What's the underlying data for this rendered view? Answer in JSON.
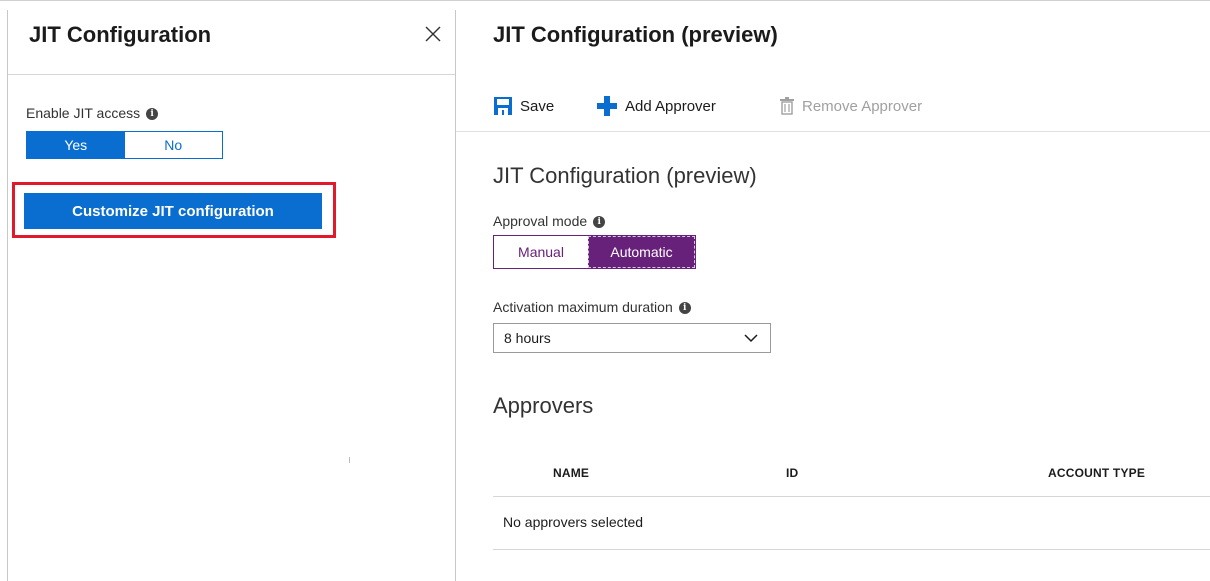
{
  "left_panel": {
    "title": "JIT Configuration",
    "enable_label": "Enable JIT access",
    "enable_toggle": {
      "yes": "Yes",
      "no": "No",
      "selected": "Yes"
    },
    "customize_button": "Customize JIT configuration"
  },
  "right_panel": {
    "title": "JIT Configuration (preview)",
    "toolbar": {
      "save": "Save",
      "add_approver": "Add Approver",
      "remove_approver": "Remove Approver"
    },
    "section_title": "JIT Configuration (preview)",
    "approval_mode": {
      "label": "Approval mode",
      "options": [
        "Manual",
        "Automatic"
      ],
      "selected": "Automatic"
    },
    "activation_duration": {
      "label": "Activation maximum duration",
      "value": "8 hours"
    },
    "approvers": {
      "title": "Approvers",
      "columns": [
        "NAME",
        "ID",
        "ACCOUNT TYPE"
      ],
      "empty_text": "No approvers selected"
    }
  },
  "colors": {
    "primary_blue": "#0a6ed1",
    "purple": "#68217a",
    "highlight_red": "#e01a2b"
  },
  "icons": {
    "info": "info-icon",
    "close": "close-icon",
    "save": "save-icon",
    "add": "plus-icon",
    "remove": "trash-icon",
    "dropdown": "chevron-down-icon"
  }
}
